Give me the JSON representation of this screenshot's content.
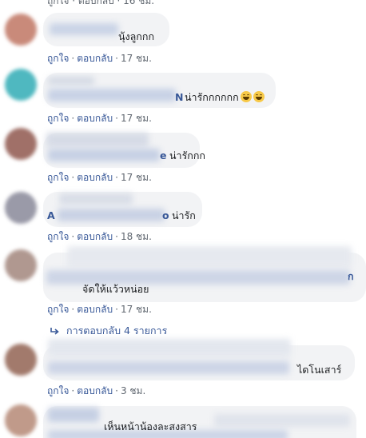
{
  "top_partial": "ถูกใจ · ตอบกลับ · 16 ชม.",
  "actions": {
    "like": "ถูกใจ",
    "reply": "ตอบกลับ",
    "sep": "·"
  },
  "comments": [
    {
      "text": "นุ้งลูกกก",
      "time": "17 ชม."
    },
    {
      "name_tail": "N",
      "text": "น่ารักกกกกก",
      "time": "17 ชม."
    },
    {
      "name_tail": "e",
      "text": "น่ารักกก",
      "time": "17 ชม."
    },
    {
      "name_head": "A",
      "name_tail": "o",
      "text": "น่ารัก",
      "time": "18 ชม."
    },
    {
      "name_tail": "ก",
      "text": "จัดให้แว้วหน่อย",
      "time": "17 ชม."
    },
    {
      "text": "ไดโนเสาร์",
      "time": "3 ชม."
    },
    {
      "text": "เห็นหน้าน้องละสงสาร"
    }
  ],
  "replies_link": "การตอบกลับ 4 รายการ",
  "colors": {
    "link": "#385898",
    "meta": "#606770",
    "bubble": "#f2f3f5"
  }
}
